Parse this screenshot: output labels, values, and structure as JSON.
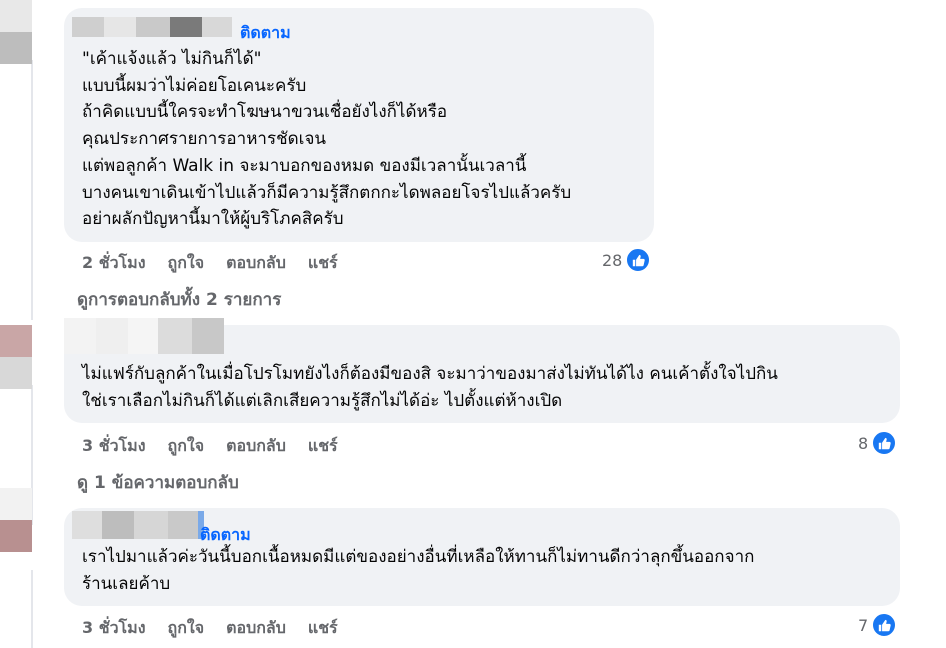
{
  "comments": [
    {
      "follow_label": "ติดตาม",
      "lines": [
        "\"เค้าแจ้งแล้ว ไม่กินก็ได้\"",
        "แบบนี้ผมว่าไม่ค่อยโอเคนะครับ",
        "ถ้าคิดแบบนี้ใครจะทำโฆษนาขวนเชื่อยังไงก็ได้หรือ",
        "คุณประกาศรายการอาหารชัดเจน",
        "แต่พอลูกค้า Walk in จะมาบอกของหมด ของมีเวลานั้นเวลานี้",
        "บางคนเขาเดินเข้าไปแล้วก็มีความรู้สึกตกกะไดพลอยโจรไปแล้วครับ",
        "อย่าผลักปัญหานี้มาให้ผู้บริโภคสิครับ"
      ],
      "time": "2 ชั่วโมง",
      "like_label": "ถูกใจ",
      "reply_label": "ตอบกลับ",
      "share_label": "แชร์",
      "reaction_count": "28",
      "reaction_icon": "like-icon",
      "view_replies": "ดูการตอบกลับทั้ง 2 รายการ"
    },
    {
      "lines": [
        "ไม่แฟร์กับลูกค้าในเมื่อโปรโมทยังไงก็ต้องมีของสิ จะมาว่าของมาส่งไม่ทันได้ไง คนเค้าตั้งใจไปกิน",
        "ใช่เราเลือกไม่กินก็ได้แต่เลิกเสียความรู้สึกไม่ได้อ่ะ ไปตั้งแต่ห้างเปิด"
      ],
      "time": "3 ชั่วโมง",
      "like_label": "ถูกใจ",
      "reply_label": "ตอบกลับ",
      "share_label": "แชร์",
      "reaction_count": "8",
      "reaction_icon": "like-icon",
      "view_replies": "ดู 1 ข้อความตอบกลับ"
    },
    {
      "follow_label": "ติดตาม",
      "lines": [
        "เราไปมาแล้วค่ะวันนี้บอกเนื้อหมดมีแต่ของอย่างอื่นที่เหลือให้ทานก็ไม่ทานดีกว่าลุกขึ้นออกจาก",
        "ร้านเลยค้าบ"
      ],
      "time": "3 ชั่วโมง",
      "like_label": "ถูกใจ",
      "reply_label": "ตอบกลับ",
      "share_label": "แชร์",
      "reaction_count": "7",
      "reaction_icon": "like-icon"
    }
  ],
  "colors": {
    "link": "#0866ff",
    "bubble": "#f0f2f5",
    "meta": "#65676b",
    "like": "#1877f2"
  }
}
